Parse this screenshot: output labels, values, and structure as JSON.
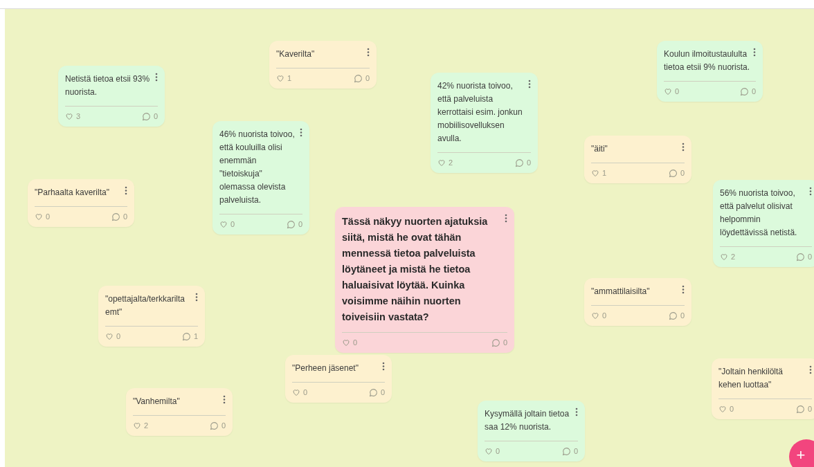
{
  "cards": [
    {
      "kind": "note",
      "color": "#dcfadc",
      "text": "Netistä tietoa etsii 93% nuorista.",
      "likes": "3",
      "comments": "0"
    },
    {
      "kind": "note",
      "color": "#fdf1cf",
      "text": "\"Kaverilta\"",
      "likes": "1",
      "comments": "0"
    },
    {
      "kind": "note",
      "color": "#dcfadc",
      "text": "46% nuorista toivoo, että kouluilla olisi enemmän \"tietoiskuja\" olemassa olevista palveluista.",
      "likes": "0",
      "comments": "0"
    },
    {
      "kind": "note",
      "color": "#fdf1cf",
      "text": "\"Parhaalta kaverilta\"",
      "likes": "0",
      "comments": "0"
    },
    {
      "kind": "note",
      "color": "#dcfadc",
      "text": "42% nuorista toivoo, että palveluista kerrottaisi esim. jonkun mobiilisovelluksen avulla.",
      "likes": "2",
      "comments": "0"
    },
    {
      "kind": "note",
      "color": "#dcfadc",
      "text": "Koulun ilmoitustaululta tietoa etsii 9% nuorista.",
      "likes": "0",
      "comments": "0"
    },
    {
      "kind": "note",
      "color": "#fdf1cf",
      "text": "\"äiti\"",
      "likes": "1",
      "comments": "0"
    },
    {
      "kind": "note",
      "color": "#dcfadc",
      "text": "56% nuorista toivoo, että palvelut olisivat helpommin löydettävissä netistä.",
      "likes": "2",
      "comments": "0"
    },
    {
      "kind": "intro",
      "color": "#fbd5d8",
      "text": "Tässä näkyy nuorten ajatuksia siitä, mistä he ovat tähän mennessä tietoa palveluista löytäneet ja mistä he tietoa haluaisivat löytää. Kuinka voisimme näihin nuorten toiveisiin vastata?",
      "likes": "0",
      "comments": "0"
    },
    {
      "kind": "note",
      "color": "#fdf1cf",
      "text": "\"opettajalta/terkkarilta emt\"",
      "likes": "0",
      "comments": "1"
    },
    {
      "kind": "note",
      "color": "#fdf1cf",
      "text": "\"ammattilaisilta\"",
      "likes": "0",
      "comments": "0"
    },
    {
      "kind": "note",
      "color": "#fdf1cf",
      "text": "\"Perheen jäsenet\"",
      "likes": "0",
      "comments": "0"
    },
    {
      "kind": "note",
      "color": "#fdf1cf",
      "text": "\"Vanhemilta\"",
      "likes": "2",
      "comments": "0"
    },
    {
      "kind": "note",
      "color": "#dcfadc",
      "text": "Kysymällä joltain tietoa saa 12% nuorista.",
      "likes": "0",
      "comments": "0"
    },
    {
      "kind": "note",
      "color": "#fdf1cf",
      "text": "\"Joltain henkilöltä kehen luottaa\"",
      "likes": "0",
      "comments": "0"
    }
  ],
  "add_button": {
    "label": "+"
  }
}
